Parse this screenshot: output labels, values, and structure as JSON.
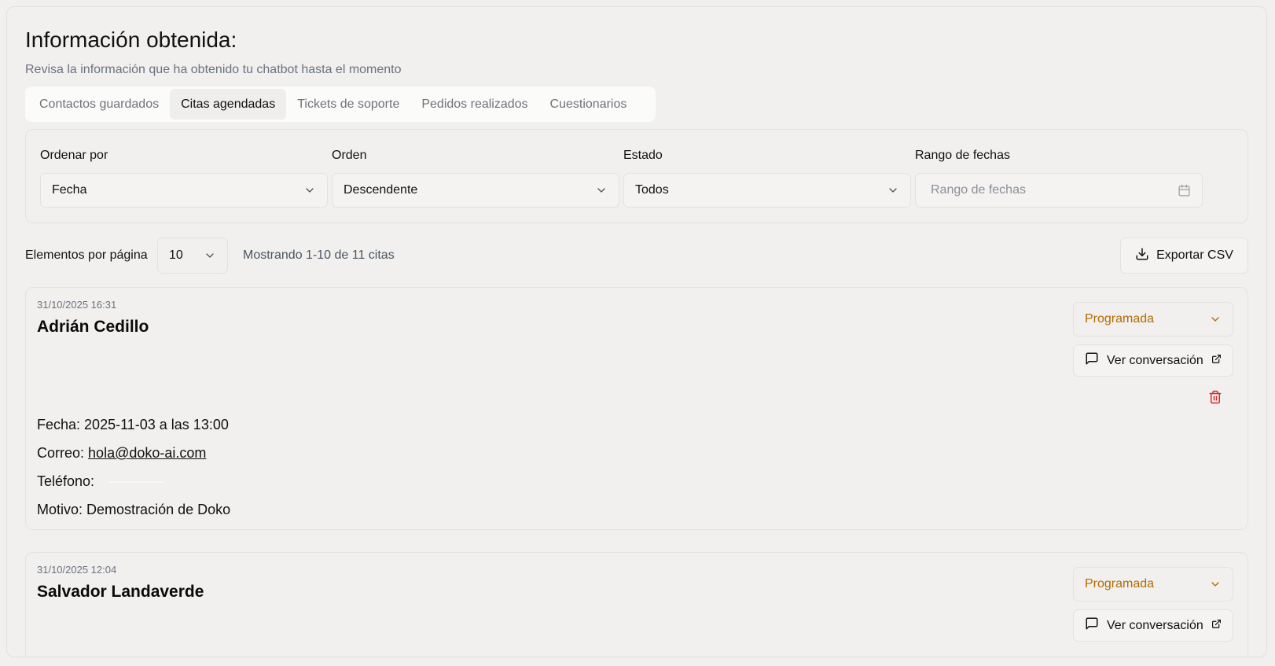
{
  "header": {
    "title": "Información obtenida:",
    "subtitle": "Revisa la información que ha obtenido tu chatbot hasta el momento"
  },
  "tabs": [
    {
      "label": "Contactos guardados",
      "active": false
    },
    {
      "label": "Citas agendadas",
      "active": true
    },
    {
      "label": "Tickets de soporte",
      "active": false
    },
    {
      "label": "Pedidos realizados",
      "active": false
    },
    {
      "label": "Cuestionarios",
      "active": false
    }
  ],
  "filters": {
    "sort_by": {
      "label": "Ordenar por",
      "value": "Fecha"
    },
    "order": {
      "label": "Orden",
      "value": "Descendente"
    },
    "status": {
      "label": "Estado",
      "value": "Todos"
    },
    "date_range": {
      "label": "Rango de fechas",
      "placeholder": "Rango de fechas"
    }
  },
  "pagination": {
    "per_page_label": "Elementos por página",
    "per_page_value": "10",
    "count_text": "Mostrando 1-10 de 11 citas"
  },
  "export_label": "Exportar CSV",
  "appointments": [
    {
      "timestamp": "31/10/2025 16:31",
      "name": "Adrián Cedillo",
      "status": "Programada",
      "conversation_label": "Ver conversación",
      "fecha_label": "Fecha:",
      "fecha_value": "2025-11-03 a las 13:00",
      "correo_label": "Correo:",
      "correo_value": "hola@doko-ai.com",
      "telefono_label": "Teléfono:",
      "motivo_label": "Motivo:",
      "motivo_value": "Demostración de Doko"
    },
    {
      "timestamp": "31/10/2025 12:04",
      "name": "Salvador Landaverde",
      "status": "Programada",
      "conversation_label": "Ver conversación"
    }
  ],
  "colors": {
    "background": "#f1f0ee",
    "status_text": "#b26b00",
    "delete_icon": "#dc2626",
    "muted_text": "#6b7280"
  },
  "icons": [
    "chevron-down-icon",
    "calendar-icon",
    "download-icon",
    "message-square-icon",
    "external-link-icon",
    "trash-icon"
  ]
}
